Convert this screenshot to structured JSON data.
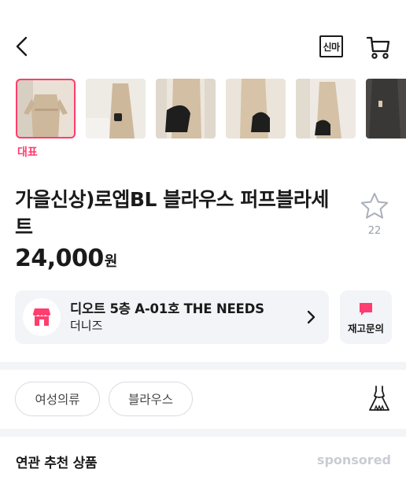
{
  "header": {
    "shinma_label": "신마",
    "icons": [
      "back-arrow-icon",
      "shinma-icon",
      "cart-icon"
    ]
  },
  "gallery": {
    "main_label": "대표",
    "thumbnail_count": 6,
    "selected_index": 0
  },
  "product": {
    "title": "가을신상)로엡BL 블라우스 퍼프블라세트",
    "price": "24,000",
    "currency": "원",
    "favorite_count": "22"
  },
  "store": {
    "name": "디오트 5층 A-01호 THE NEEDS",
    "sub": "더니즈",
    "inquiry_label": "재고문의"
  },
  "tags": [
    "여성의류",
    "블라우스"
  ],
  "recommend": {
    "title": "연관 추천 상품",
    "sponsored": "sponsored"
  },
  "colors": {
    "accent": "#ff3d6e",
    "card_bg": "#f2f4f8",
    "muted": "#9aa0a8"
  }
}
